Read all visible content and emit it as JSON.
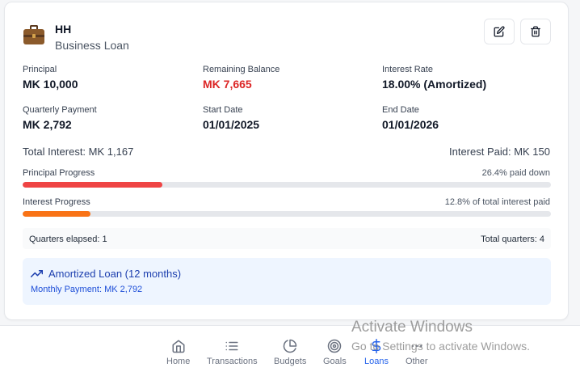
{
  "loan": {
    "name": "HH",
    "type": "Business Loan",
    "icon": "briefcase-icon"
  },
  "actions": {
    "edit_icon": "edit-icon",
    "delete_icon": "trash-icon"
  },
  "fields": {
    "principal": {
      "label": "Principal",
      "value": "MK 10,000"
    },
    "remaining": {
      "label": "Remaining Balance",
      "value": "MK 7,665"
    },
    "rate": {
      "label": "Interest Rate",
      "value": "18.00% (Amortized)"
    },
    "payment": {
      "label": "Quarterly Payment",
      "value": "MK 2,792"
    },
    "start": {
      "label": "Start Date",
      "value": "01/01/2025"
    },
    "end": {
      "label": "End Date",
      "value": "01/01/2026"
    }
  },
  "totals": {
    "total_interest": "Total Interest: MK 1,167",
    "interest_paid": "Interest Paid: MK 150"
  },
  "progress": {
    "principal": {
      "label": "Principal Progress",
      "status": "26.4% paid down",
      "percent": 26.4,
      "color": "#ef4444"
    },
    "interest": {
      "label": "Interest Progress",
      "status": "12.8% of total interest paid",
      "percent": 12.8,
      "color": "#f97316"
    }
  },
  "quarters": {
    "elapsed": "Quarters elapsed: 1",
    "total": "Total quarters: 4"
  },
  "amortization": {
    "title": "Amortized Loan (12 months)",
    "subtitle": "Monthly Payment: MK 2,792",
    "icon": "trending-up-icon"
  },
  "nav": [
    {
      "label": "Home",
      "icon": "home-icon",
      "active": false
    },
    {
      "label": "Transactions",
      "icon": "list-icon",
      "active": false
    },
    {
      "label": "Budgets",
      "icon": "pie-chart-icon",
      "active": false
    },
    {
      "label": "Goals",
      "icon": "target-icon",
      "active": false
    },
    {
      "label": "Loans",
      "icon": "dollar-icon",
      "active": true
    },
    {
      "label": "Other",
      "icon": "more-icon",
      "active": false
    }
  ],
  "watermark": {
    "line1": "Activate Windows",
    "line2": "Go to Settings to activate Windows."
  },
  "colors": {
    "accent": "#2563eb",
    "danger": "#dc2626"
  }
}
